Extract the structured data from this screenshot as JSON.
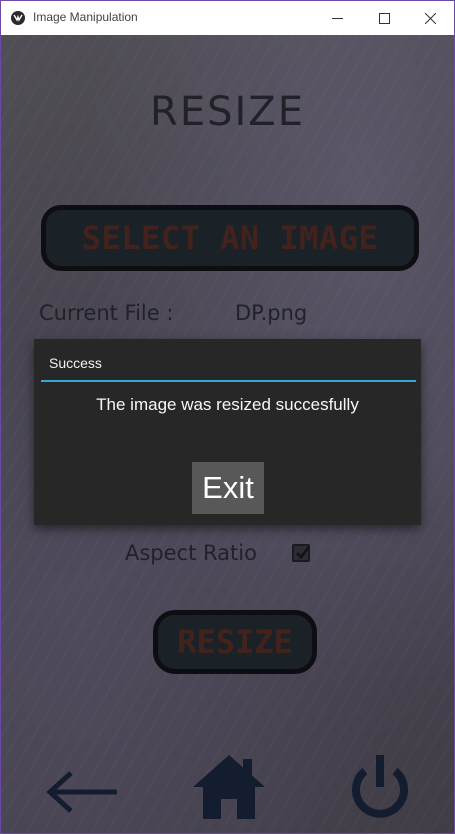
{
  "window": {
    "title": "Image Manipulation"
  },
  "page": {
    "title": "RESIZE",
    "select_image_label": "SELECT AN IMAGE",
    "current_file_label": "Current File :",
    "current_file_value": "DP.png",
    "aspect_ratio_label": "Aspect Ratio",
    "aspect_ratio_checked": true,
    "resize_label": "RESIZE"
  },
  "nav": {
    "icons": [
      "back-arrow-icon",
      "home-icon",
      "power-icon"
    ]
  },
  "popup": {
    "title": "Success",
    "message": "The image was resized succesfully",
    "exit_label": "Exit",
    "accent_color": "#35a8d6"
  },
  "colors": {
    "button_fill": "#1e2a30",
    "button_text": "#5c2a1e",
    "text_dark": "#2a2833"
  }
}
